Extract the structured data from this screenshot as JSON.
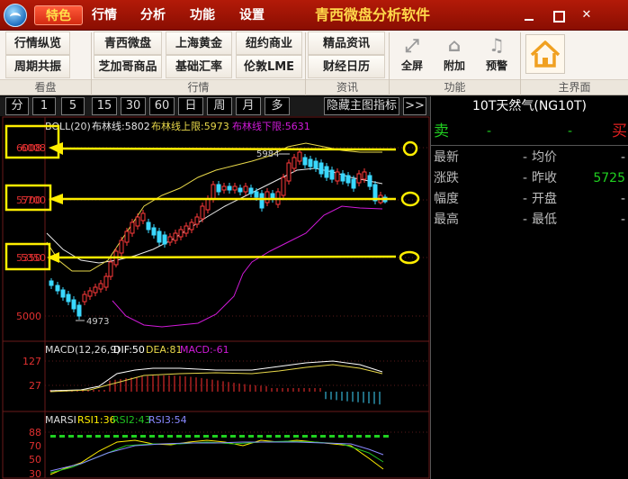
{
  "titlebar": {
    "menus": [
      "特色",
      "行情",
      "分析",
      "功能",
      "设置"
    ],
    "app_title": "青西微盘分析软件"
  },
  "toolbar": {
    "buttons": [
      [
        "行情纵览",
        "周期共振"
      ],
      [
        "青西微盘",
        "芝加哥商品"
      ],
      [
        "上海黄金",
        "基础汇率"
      ],
      [
        "纽约商业",
        "伦敦LME"
      ],
      [
        "精品资讯",
        "财经日历"
      ]
    ],
    "big_buttons": [
      "全屏",
      "附加",
      "预警"
    ],
    "groups": [
      "看盘",
      "行情",
      "资讯",
      "功能",
      "主界面"
    ]
  },
  "periodbar": {
    "items": [
      "分",
      "1",
      "5",
      "15",
      "30",
      "60",
      "日",
      "周",
      "月",
      "多"
    ],
    "hide_indicator": "隐藏主图指标",
    "more": ">>"
  },
  "quote": {
    "title": "10T天然气(NG10T)",
    "sell": "卖",
    "sell_val": "-",
    "sell_val2": "-",
    "buy": "买",
    "rows": [
      {
        "l1": "最新",
        "d": "-",
        "l2": "均价",
        "v": "-"
      },
      {
        "l1": "涨跌",
        "d": "-",
        "l2": "昨收",
        "v": "5725"
      },
      {
        "l1": "幅度",
        "d": "-",
        "l2": "开盘",
        "v": "-"
      },
      {
        "l1": "最高",
        "d": "-",
        "l2": "最低",
        "v": "-"
      }
    ]
  },
  "main_chart": {
    "indicator": "BOLL(20)",
    "mid_label": "布林线:5802",
    "upper_label": "布林线上限:5973",
    "lower_label": "布林线下限:5631",
    "y_ticks": [
      6008,
      5700,
      5350,
      5000
    ],
    "high_label": "5984",
    "low_label": "4973",
    "colors": {
      "up": "#ff3a3a",
      "down": "#3ad8ff",
      "mid": "#e8e8e8",
      "upper": "#e8d84a",
      "lower": "#d01ad8",
      "annot": "#ffee00"
    }
  },
  "macd": {
    "title": "MACD(12,26,9)",
    "dif": "DIF:50",
    "dea": "DEA:81",
    "macd": "MACD:-61",
    "y_ticks": [
      127,
      27
    ]
  },
  "marsi": {
    "title": "MARSI",
    "rsi1": "RSI1:36",
    "rsi2": "RSI2:43",
    "rsi3": "RSI3:54",
    "y_ticks": [
      88,
      70,
      50,
      30
    ]
  }
}
